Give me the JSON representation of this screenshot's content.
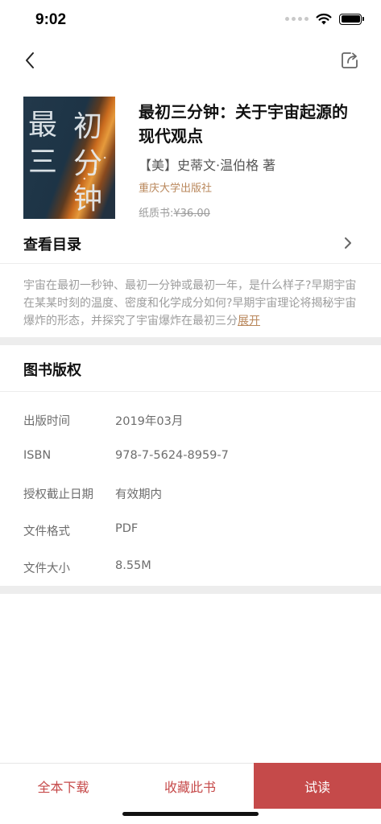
{
  "status_bar": {
    "time": "9:02"
  },
  "book": {
    "title": "最初三分钟：关于宇宙起源的现代观点",
    "author": "【美】史蒂文·温伯格 著",
    "publisher": "重庆大学出版社",
    "paper_label": "纸质书:",
    "paper_price": "¥36.00",
    "cover_chars": [
      "最",
      "初",
      "三",
      "分",
      "钟"
    ]
  },
  "toc": {
    "label": "查看目录"
  },
  "description": {
    "text": "宇宙在最初一秒钟、最初一分钟或最初一年，是什么样子?早期宇宙在某某时刻的温度、密度和化学成分如何?早期宇宙理论将揭秘宇宙爆炸的形态，并探究了宇宙爆炸在最初三分",
    "expand_label": "展开"
  },
  "copyright": {
    "title": "图书版权",
    "rows": [
      {
        "label": "出版时间",
        "value": "2019年03月"
      },
      {
        "label": "ISBN",
        "value": "978-7-5624-8959-7"
      },
      {
        "label": "授权截止日期",
        "value": "有效期内"
      },
      {
        "label": "文件格式",
        "value": "PDF"
      },
      {
        "label": "文件大小",
        "value": "8.55M"
      }
    ]
  },
  "bottom_bar": {
    "download_label": "全本下载",
    "favorite_label": "收藏此书",
    "read_label": "试读"
  },
  "colors": {
    "accent": "#c54a4a",
    "publisher": "#b9875b",
    "muted": "#9d9d9d"
  },
  "icons": {
    "back": "chevron-left-icon",
    "share": "share-icon",
    "toc": "chevron-right-icon",
    "wifi": "wifi-icon",
    "battery": "battery-icon"
  }
}
